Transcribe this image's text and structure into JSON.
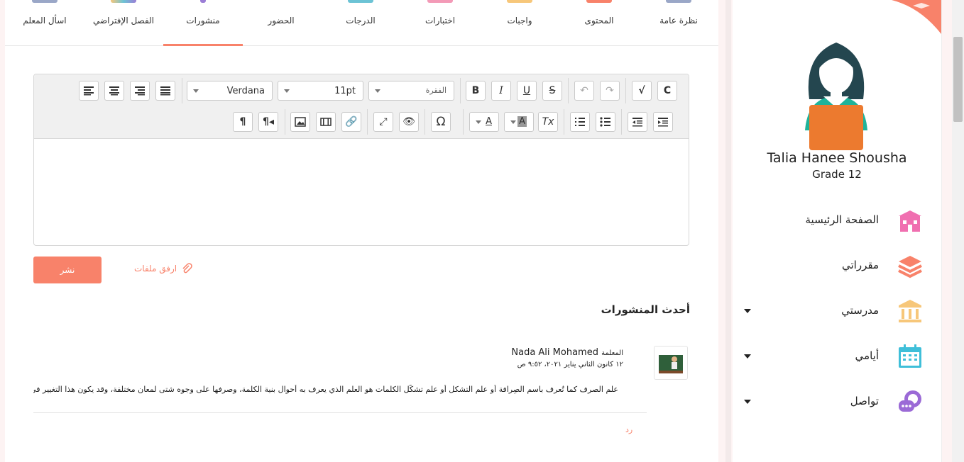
{
  "tabs": [
    {
      "label": "نظرة عامة",
      "color": "#9aa7c7"
    },
    {
      "label": "المحتوى",
      "color": "#f8826a"
    },
    {
      "label": "واجبات",
      "color": "#f7c77a"
    },
    {
      "label": "اختبارات",
      "color": "#f39ab7"
    },
    {
      "label": "الدرجات",
      "color": "#6cc3d5"
    },
    {
      "label": "الحضور",
      "color": "#aaaaaa"
    },
    {
      "label": "منشورات",
      "color": "#9b7ed6",
      "active": true
    },
    {
      "label": "الفصل الإفتراضي",
      "color": "#f7c77a"
    },
    {
      "label": "اسأل المعلم",
      "color": "#9aa7c7"
    }
  ],
  "editor": {
    "font_family": "Verdana",
    "font_size": "11pt",
    "block_format": "الفقرة",
    "toolbar_icons": [
      "align-left-icon",
      "align-center-icon",
      "align-right-icon",
      "align-justify-icon",
      "bold-icon",
      "italic-icon",
      "underline-icon",
      "strikethrough-icon",
      "undo-icon",
      "redo-icon",
      "math-icon",
      "chemistry-icon",
      "ltr-icon",
      "rtl-icon",
      "image-icon",
      "media-icon",
      "link-icon",
      "fullscreen-icon",
      "preview-icon",
      "special-char-icon",
      "text-color-icon",
      "background-color-icon",
      "clear-format-icon",
      "numbered-list-icon",
      "bullet-list-icon",
      "outdent-icon",
      "indent-icon"
    ],
    "content": ""
  },
  "actions": {
    "publish_label": "نشر",
    "attach_label": "ارفق ملفات"
  },
  "feed": {
    "title": "أحدث المنشورات",
    "posts": [
      {
        "role": "المعلمة",
        "author": "Nada Ali Mohamed",
        "timestamp": "١٢ كانون الثاني يناير ٢٠٢١، ٩:٥٢ ص",
        "body": "علم الصرف كما تُعرف باسم الصِرافة أو علم التشكل أو علم تشكُّل الكلمات هو العلم الذي يعرف به أحوال بنية الكلمة، وصرفها على وجوه شتى لمعان مختلفة، وقد يكون هذا التغيير في هذه البنية إما",
        "reply_label": "رد"
      }
    ]
  },
  "profile": {
    "name": "Talia Hanee Shousha",
    "grade": "Grade 12"
  },
  "nav": [
    {
      "label": "الصفحة الرئيسية",
      "icon": "school-building-icon",
      "color": "#f06fb0",
      "dropdown": false
    },
    {
      "label": "مقرراتي",
      "icon": "books-stack-icon",
      "color": "#f8826a",
      "dropdown": false
    },
    {
      "label": "مدرستي",
      "icon": "institution-icon",
      "color": "#f7c77a",
      "dropdown": true
    },
    {
      "label": "أيامي",
      "icon": "calendar-icon",
      "color": "#3fbfd9",
      "dropdown": true
    },
    {
      "label": "تواصل",
      "icon": "chat-bubbles-icon",
      "color": "#9b6ad6",
      "dropdown": true
    }
  ],
  "colors": {
    "accent": "#f8826a",
    "page_bg": "#fdf3f3"
  }
}
